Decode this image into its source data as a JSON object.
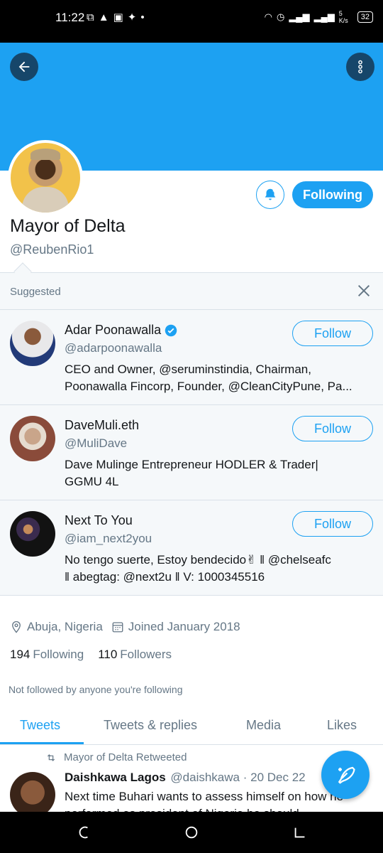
{
  "status_bar": {
    "time": "11:22",
    "network_speed": "5 K/s",
    "battery": "32"
  },
  "profile": {
    "display_name": "Mayor of Delta",
    "handle": "@ReubenRio1",
    "following_button": "Following",
    "location": "Abuja, Nigeria",
    "joined": "Joined January 2018",
    "following_count": "194",
    "following_label": "Following",
    "followers_count": "110",
    "followers_label": "Followers",
    "not_followed_text": "Not followed by anyone you're following"
  },
  "suggested": {
    "heading": "Suggested",
    "items": [
      {
        "name": "Adar Poonawalla",
        "verified": true,
        "handle": "@adarpoonawalla",
        "bio_line1": "CEO and Owner, @seruminstindia, Chairman,",
        "bio_line2": "Poonawalla Fincorp, Founder, @CleanCityPune, Pa...",
        "button": "Follow"
      },
      {
        "name": "DaveMuli.eth",
        "verified": false,
        "handle": "@MuliDave",
        "bio_line1": "Dave Mulinge Entrepreneur HODLER  & Trader|",
        "bio_line2": "GGMU 4L",
        "button": "Follow"
      },
      {
        "name": "Next To You",
        "verified": false,
        "handle": "@iam_next2you",
        "bio_line1": "No tengo suerte, Estoy bendecido✌  ‖ @chelseafc",
        "bio_line2": "‖  abegtag: @next2u ‖   V: 1000345516",
        "button": "Follow"
      }
    ]
  },
  "tabs": [
    {
      "label": "Tweets",
      "active": true
    },
    {
      "label": "Tweets & replies",
      "active": false
    },
    {
      "label": "Media",
      "active": false
    },
    {
      "label": "Likes",
      "active": false
    }
  ],
  "tweet": {
    "retweet_label": "Mayor of Delta Retweeted",
    "author_name": "Daishkawa Lagos",
    "author_handle": "@daishkawa",
    "date": "· 20 Dec 22",
    "text": "Next time Buhari wants to assess himself on how he performed as president of Nigeria he should..."
  },
  "colors": {
    "brand_blue": "#1da1f2",
    "banner": "#1da1f2",
    "secondary_text": "#657786"
  },
  "icons": {
    "back": "arrow-left-icon",
    "more": "more-vertical-icon",
    "notify": "bell-plus-icon",
    "location": "location-pin-icon",
    "calendar": "calendar-icon",
    "retweet": "retweet-icon",
    "compose": "compose-feather-icon"
  }
}
